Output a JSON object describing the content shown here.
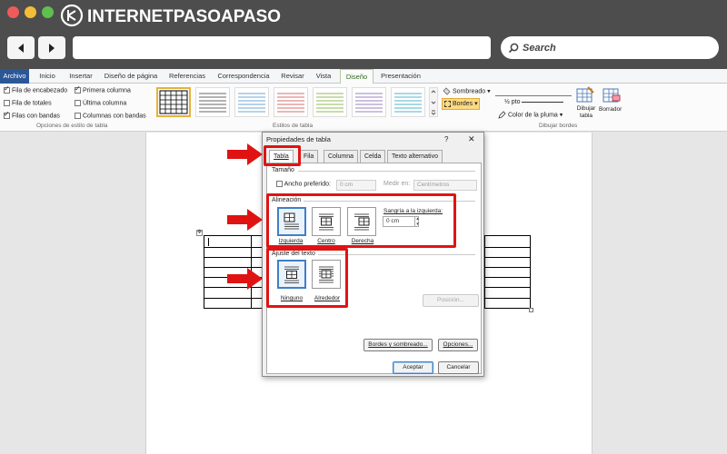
{
  "browser": {
    "logo_text": "INTERNETPASOAPASO",
    "search_label": "Search",
    "colors": {
      "red": "#ee5b5b",
      "yellow": "#f4bd38",
      "green": "#5fbf4f"
    }
  },
  "ribbon": {
    "tabs": [
      "Archivo",
      "Inicio",
      "Insertar",
      "Diseño de página",
      "Referencias",
      "Correspondencia",
      "Revisar",
      "Vista",
      "Diseño",
      "Presentación"
    ],
    "active_tab": "Diseño",
    "style_options": {
      "col1": [
        {
          "label": "Fila de encabezado",
          "checked": true
        },
        {
          "label": "Fila de totales",
          "checked": false
        },
        {
          "label": "Filas con bandas",
          "checked": true
        }
      ],
      "col2": [
        {
          "label": "Primera columna",
          "checked": true
        },
        {
          "label": "Última columna",
          "checked": false
        },
        {
          "label": "Columnas con bandas",
          "checked": false
        }
      ],
      "group_label": "Opciones de estilo de tabla"
    },
    "styles_group_label": "Estilos de tabla",
    "sombreado": "Sombreado",
    "bordes": "Bordes",
    "pen_weight": "½ pto",
    "pen_color": "Color de la pluma",
    "dibujar_tabla": "Dibujar tabla",
    "borrador": "Borrador",
    "dibujar_bordes_label": "Dibujar bordes"
  },
  "dialog": {
    "title": "Propiedades de tabla",
    "help": "?",
    "close": "✕",
    "tabs": [
      "Tabla",
      "Fila",
      "Columna",
      "Celda",
      "Texto alternativo"
    ],
    "active_tab": "Tabla",
    "size_group": "Tamaño",
    "preferred_width_label": "Ancho preferido:",
    "preferred_width_value": "0 cm",
    "measure_label": "Medir en:",
    "measure_value": "Centímetros",
    "alignment_group": "Alineación",
    "alignment_options": [
      "Izquierda",
      "Centro",
      "Derecha"
    ],
    "alignment_selected": "Izquierda",
    "indent_label": "Sangría a la izquierda:",
    "indent_value": "0 cm",
    "wrap_group": "Ajuste del texto",
    "wrap_options": [
      "Ninguno",
      "Alrededor"
    ],
    "wrap_selected": "Ninguno",
    "positioning_btn": "Posición...",
    "borders_btn": "Bordes y sombreado...",
    "options_btn": "Opciones...",
    "ok_btn": "Aceptar",
    "cancel_btn": "Cancelar"
  }
}
